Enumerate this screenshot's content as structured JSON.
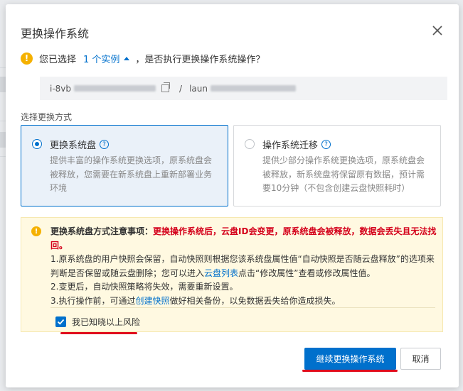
{
  "dialog": {
    "title": "更换操作系统",
    "close_icon": "close-icon"
  },
  "info": {
    "prefix": "您已选择",
    "instances_link": "1 个实例",
    "suffix": "，是否执行更换操作系统操作？"
  },
  "instance": {
    "id_prefix": "i-8vb",
    "separator": "/",
    "name_prefix": "laun"
  },
  "section_label": "选择更换方式",
  "options": [
    {
      "title": "更换系统盘",
      "selected": true,
      "description": "提供丰富的操作系统更换选项，原系统盘会被释放，您需要在新系统盘上重新部署业务环境"
    },
    {
      "title": "操作系统迁移",
      "selected": false,
      "description": "提供少部分操作系统更换选项，原系统盘会被释放，新系统盘将保留原有数据，预计需要10分钟（不包含创建云盘快照耗时）"
    }
  ],
  "notice": {
    "heading": "更换系统盘方式注意事项：",
    "warning": "更换操作系统后，云盘ID会变更，原系统盘会被释放，数据会丢失且无法找回。",
    "item1_a": "1.原系统盘的用户快照会保留，自动快照则根据您该系统盘属性值“自动快照是否随云盘释放”的选项来判断是否保留或随云盘删除；您可以进入",
    "item1_link": "云盘列表",
    "item1_b": "点击“修改属性”查看或修改属性值。",
    "item2": "2.变更后，自动快照策略将失效，需要重新设置。",
    "item3_a": "3.执行操作前，可通过",
    "item3_link": "创建快照",
    "item3_b": "做好相关备份，以免数据丢失给你造成损失。",
    "acknowledge": "我已知晓以上风险",
    "acknowledge_checked": true
  },
  "buttons": {
    "confirm": "继续更换操作系统",
    "cancel": "取消"
  },
  "colors": {
    "accent": "#0070cc",
    "warning": "#f5b100",
    "danger": "#d4001a"
  }
}
